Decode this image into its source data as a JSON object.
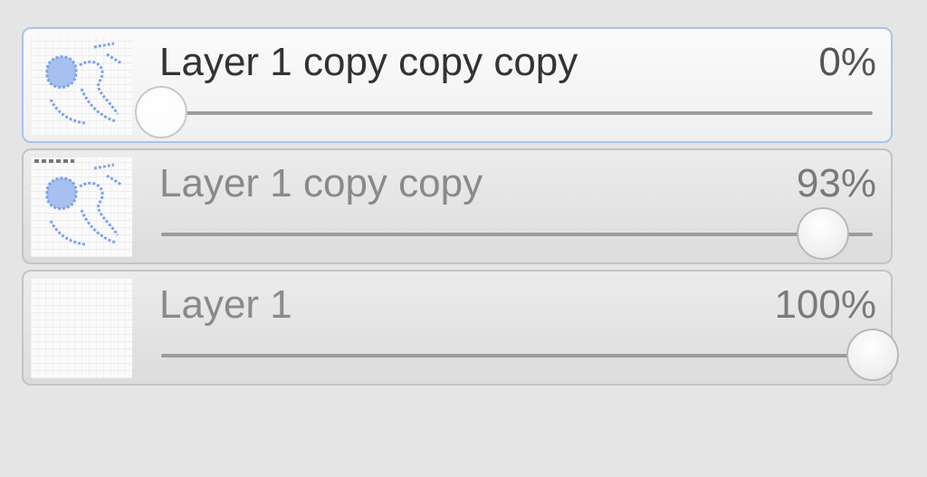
{
  "layers_panel": {
    "layers": [
      {
        "name": "Layer 1 copy copy copy",
        "opacity_label": "0%",
        "opacity": 0,
        "selected": true,
        "thumbnail": "layer-art"
      },
      {
        "name": "Layer 1 copy copy",
        "opacity_label": "93%",
        "opacity": 93,
        "selected": false,
        "thumbnail": "layer-art"
      },
      {
        "name": "Layer 1",
        "opacity_label": "100%",
        "opacity": 100,
        "selected": false,
        "thumbnail": "blank"
      }
    ]
  },
  "colors": {
    "selection_border": "#a9c3ea",
    "thumbnail_art": "#7fa3e8"
  }
}
